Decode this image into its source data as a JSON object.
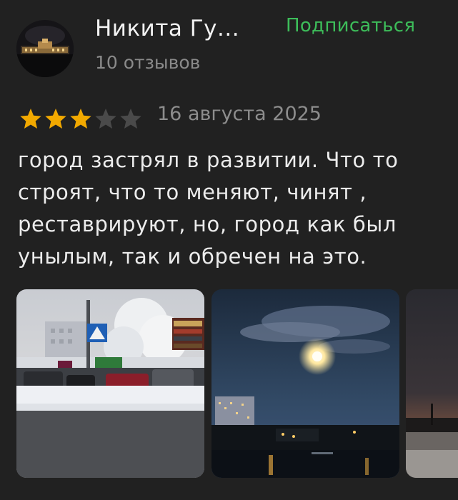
{
  "author": {
    "name": "Никита Гу...",
    "reviews_count": "10 отзывов",
    "subscribe_label": "Подписаться"
  },
  "review": {
    "rating": 3,
    "max_rating": 5,
    "date": "16 августа 2025",
    "text_lines": [
      "город застрял в развитии. Что то",
      "строят, что то меняют, чинят ,",
      "реставрируют, но, город как был",
      "унылым, так и обречен на это."
    ]
  },
  "colors": {
    "background": "#212121",
    "star_filled": "#f2a900",
    "star_empty": "#4a4a4a",
    "subscribe": "#3dbd5a",
    "secondary_text": "#8a8a8a"
  },
  "photos": [
    {
      "alt": "winter-street-photo"
    },
    {
      "alt": "night-moon-photo"
    },
    {
      "alt": "dusk-photo"
    }
  ]
}
